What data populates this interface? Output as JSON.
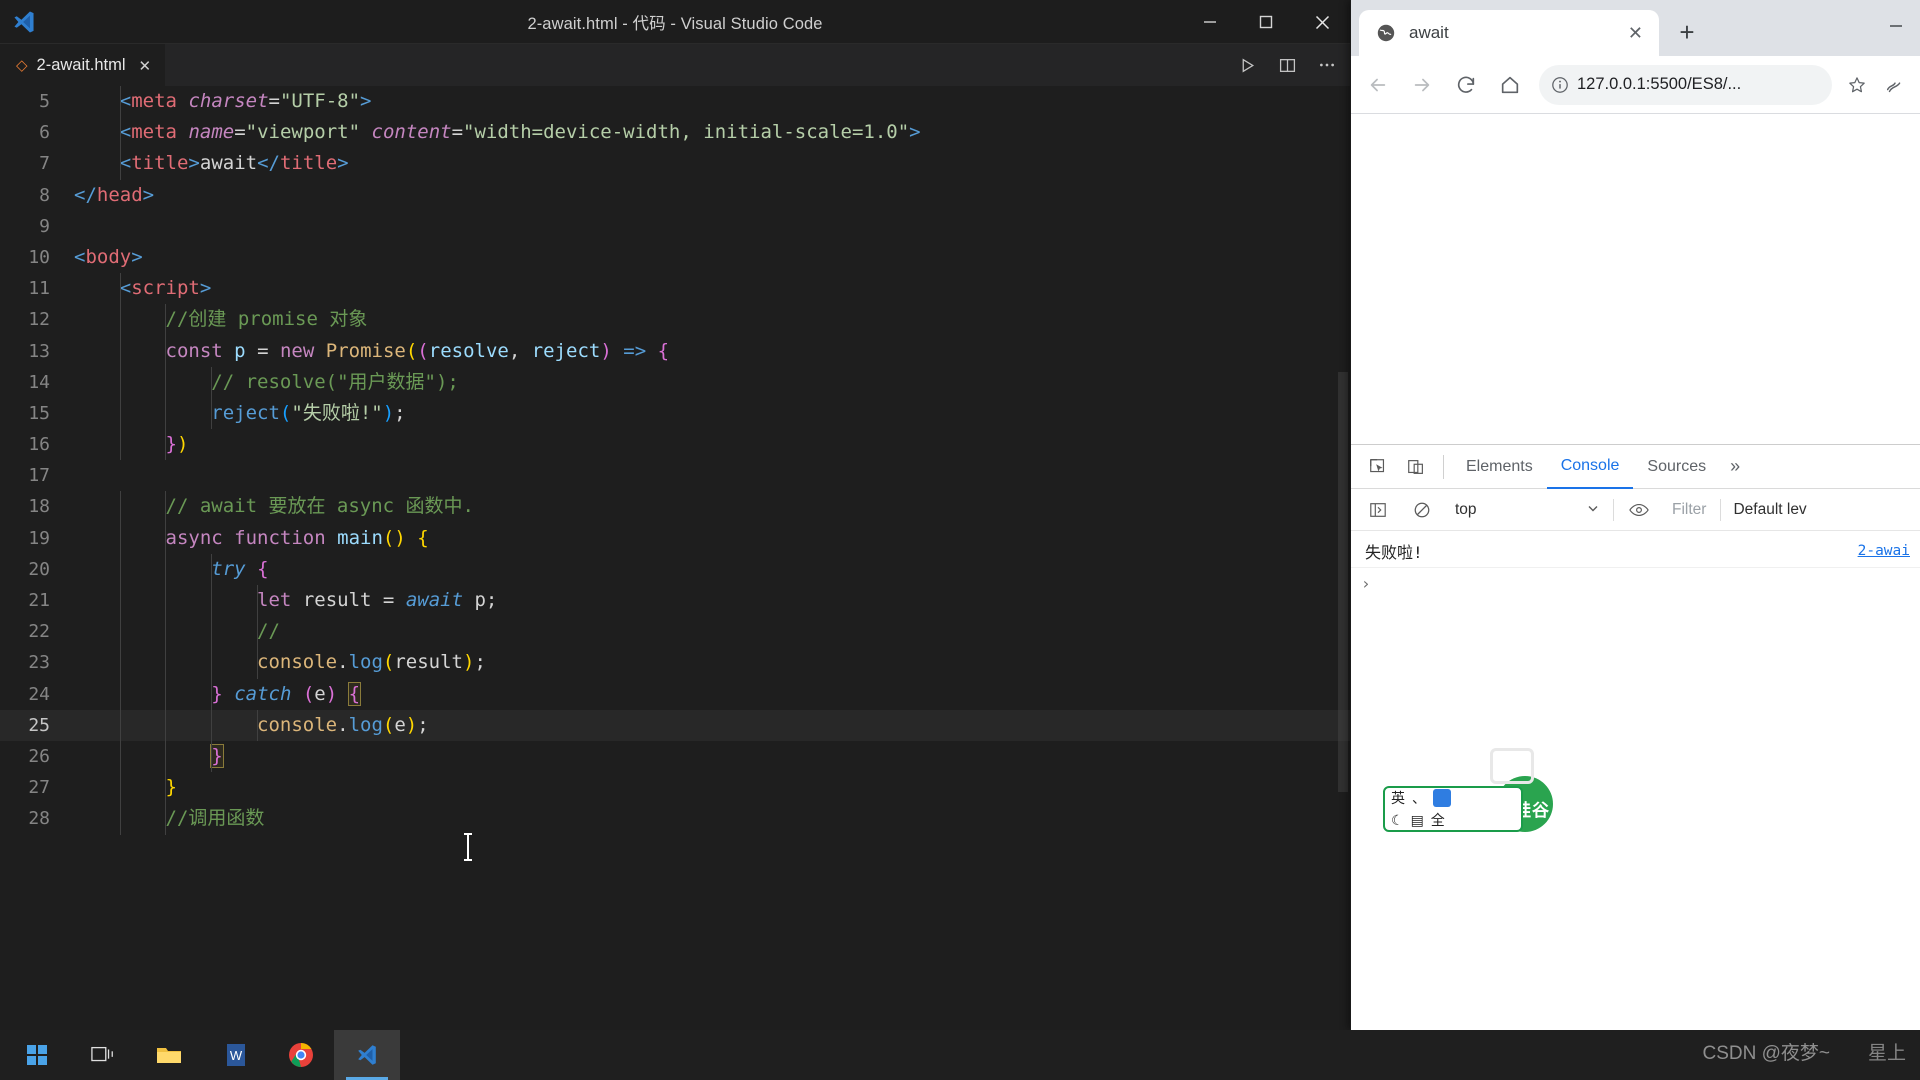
{
  "vscode": {
    "window_title": "2-await.html - 代码 - Visual Studio Code",
    "logo_icon": "vscode-logo-icon",
    "tab": {
      "file_icon": "html-file-icon",
      "label": "2-await.html",
      "close_icon": "close-icon"
    },
    "tab_actions": [
      {
        "name": "run-button",
        "icon": "play-icon"
      },
      {
        "name": "split-editor-button",
        "icon": "split-editor-icon"
      },
      {
        "name": "more-actions-button",
        "icon": "ellipsis-icon"
      }
    ],
    "window_controls": [
      {
        "name": "minimize-button",
        "icon": "minimize-icon"
      },
      {
        "name": "maximize-button",
        "icon": "maximize-icon"
      },
      {
        "name": "close-button",
        "icon": "close-icon"
      }
    ],
    "code": [
      {
        "n": "5",
        "cur": false,
        "indent": 2,
        "tokens": [
          {
            "t": "    ",
            "c": "t-txt"
          },
          {
            "t": "<",
            "c": "t-tag"
          },
          {
            "t": "meta",
            "c": "t-tagname"
          },
          {
            "t": " ",
            "c": "t-txt"
          },
          {
            "t": "charset",
            "c": "t-attr"
          },
          {
            "t": "=",
            "c": "t-pun"
          },
          {
            "t": "\"UTF-8\"",
            "c": "t-strv"
          },
          {
            "t": ">",
            "c": "t-tag"
          }
        ]
      },
      {
        "n": "6",
        "cur": false,
        "indent": 2,
        "tokens": [
          {
            "t": "    ",
            "c": "t-txt"
          },
          {
            "t": "<",
            "c": "t-tag"
          },
          {
            "t": "meta",
            "c": "t-tagname"
          },
          {
            "t": " ",
            "c": "t-txt"
          },
          {
            "t": "name",
            "c": "t-attr"
          },
          {
            "t": "=",
            "c": "t-pun"
          },
          {
            "t": "\"viewport\"",
            "c": "t-strv"
          },
          {
            "t": " ",
            "c": "t-txt"
          },
          {
            "t": "content",
            "c": "t-attr"
          },
          {
            "t": "=",
            "c": "t-pun"
          },
          {
            "t": "\"width=device-width, initial-scale=1.0\"",
            "c": "t-strv"
          },
          {
            "t": ">",
            "c": "t-tag"
          }
        ]
      },
      {
        "n": "7",
        "cur": false,
        "indent": 2,
        "tokens": [
          {
            "t": "    ",
            "c": "t-txt"
          },
          {
            "t": "<",
            "c": "t-tag"
          },
          {
            "t": "title",
            "c": "t-tagname"
          },
          {
            "t": ">",
            "c": "t-tag"
          },
          {
            "t": "await",
            "c": "t-txt"
          },
          {
            "t": "</",
            "c": "t-tag"
          },
          {
            "t": "title",
            "c": "t-tagname"
          },
          {
            "t": ">",
            "c": "t-tag"
          }
        ]
      },
      {
        "n": "8",
        "cur": false,
        "indent": 1,
        "tokens": [
          {
            "t": "</",
            "c": "t-tag"
          },
          {
            "t": "head",
            "c": "t-tagname"
          },
          {
            "t": ">",
            "c": "t-tag"
          }
        ]
      },
      {
        "n": "9",
        "cur": false,
        "indent": 0,
        "tokens": []
      },
      {
        "n": "10",
        "cur": false,
        "indent": 1,
        "tokens": [
          {
            "t": "<",
            "c": "t-tag"
          },
          {
            "t": "body",
            "c": "t-tagname"
          },
          {
            "t": ">",
            "c": "t-tag"
          }
        ]
      },
      {
        "n": "11",
        "cur": false,
        "indent": 2,
        "tokens": [
          {
            "t": "    ",
            "c": "t-txt"
          },
          {
            "t": "<",
            "c": "t-tag"
          },
          {
            "t": "script",
            "c": "t-tagname"
          },
          {
            "t": ">",
            "c": "t-tag"
          }
        ]
      },
      {
        "n": "12",
        "cur": false,
        "indent": 3,
        "tokens": [
          {
            "t": "        ",
            "c": "t-txt"
          },
          {
            "t": "//创建 promise 对象",
            "c": "t-cmt"
          }
        ]
      },
      {
        "n": "13",
        "cur": false,
        "indent": 3,
        "tokens": [
          {
            "t": "        ",
            "c": "t-txt"
          },
          {
            "t": "const",
            "c": "t-kw"
          },
          {
            "t": " ",
            "c": "t-txt"
          },
          {
            "t": "p",
            "c": "t-var"
          },
          {
            "t": " ",
            "c": "t-txt"
          },
          {
            "t": "=",
            "c": "t-pun"
          },
          {
            "t": " ",
            "c": "t-txt"
          },
          {
            "t": "new",
            "c": "t-kw"
          },
          {
            "t": " ",
            "c": "t-txt"
          },
          {
            "t": "Promise",
            "c": "t-obj"
          },
          {
            "t": "(",
            "c": "t-br1"
          },
          {
            "t": "(",
            "c": "t-br2"
          },
          {
            "t": "resolve",
            "c": "t-var"
          },
          {
            "t": ",",
            "c": "t-pun"
          },
          {
            "t": " ",
            "c": "t-txt"
          },
          {
            "t": "reject",
            "c": "t-var"
          },
          {
            "t": ")",
            "c": "t-br2"
          },
          {
            "t": " ",
            "c": "t-txt"
          },
          {
            "t": "=>",
            "c": "t-kw2"
          },
          {
            "t": " ",
            "c": "t-txt"
          },
          {
            "t": "{",
            "c": "t-br2"
          }
        ]
      },
      {
        "n": "14",
        "cur": false,
        "indent": 4,
        "tokens": [
          {
            "t": "            ",
            "c": "t-txt"
          },
          {
            "t": "// resolve(\"用户数据\");",
            "c": "t-cmt"
          }
        ]
      },
      {
        "n": "15",
        "cur": false,
        "indent": 4,
        "tokens": [
          {
            "t": "            ",
            "c": "t-txt"
          },
          {
            "t": "reject",
            "c": "t-kw2"
          },
          {
            "t": "(",
            "c": "t-br3"
          },
          {
            "t": "\"失败啦!\"",
            "c": "t-strv"
          },
          {
            "t": ")",
            "c": "t-br3"
          },
          {
            "t": ";",
            "c": "t-pun"
          }
        ]
      },
      {
        "n": "16",
        "cur": false,
        "indent": 3,
        "tokens": [
          {
            "t": "        ",
            "c": "t-txt"
          },
          {
            "t": "}",
            "c": "t-br2"
          },
          {
            "t": ")",
            "c": "t-br1"
          }
        ]
      },
      {
        "n": "17",
        "cur": false,
        "indent": 0,
        "tokens": []
      },
      {
        "n": "18",
        "cur": false,
        "indent": 3,
        "tokens": [
          {
            "t": "        ",
            "c": "t-txt"
          },
          {
            "t": "// await 要放在 async 函数中.",
            "c": "t-cmt"
          }
        ]
      },
      {
        "n": "19",
        "cur": false,
        "indent": 3,
        "tokens": [
          {
            "t": "        ",
            "c": "t-txt"
          },
          {
            "t": "async",
            "c": "t-kw"
          },
          {
            "t": " ",
            "c": "t-txt"
          },
          {
            "t": "function",
            "c": "t-kw"
          },
          {
            "t": " ",
            "c": "t-txt"
          },
          {
            "t": "main",
            "c": "t-var"
          },
          {
            "t": "(",
            "c": "t-br1"
          },
          {
            "t": ")",
            "c": "t-br1"
          },
          {
            "t": " ",
            "c": "t-txt"
          },
          {
            "t": "{",
            "c": "t-br1"
          }
        ]
      },
      {
        "n": "20",
        "cur": false,
        "indent": 4,
        "tokens": [
          {
            "t": "            ",
            "c": "t-txt"
          },
          {
            "t": "try",
            "c": "t-kw2 t-italic"
          },
          {
            "t": " ",
            "c": "t-txt"
          },
          {
            "t": "{",
            "c": "t-br2"
          }
        ]
      },
      {
        "n": "21",
        "cur": false,
        "indent": 5,
        "tokens": [
          {
            "t": "                ",
            "c": "t-txt"
          },
          {
            "t": "let",
            "c": "t-kw"
          },
          {
            "t": " ",
            "c": "t-txt"
          },
          {
            "t": "result",
            "c": "t-txt"
          },
          {
            "t": " ",
            "c": "t-txt"
          },
          {
            "t": "=",
            "c": "t-pun"
          },
          {
            "t": " ",
            "c": "t-txt"
          },
          {
            "t": "await",
            "c": "t-kw2 t-italic"
          },
          {
            "t": " ",
            "c": "t-txt"
          },
          {
            "t": "p",
            "c": "t-txt"
          },
          {
            "t": ";",
            "c": "t-pun"
          }
        ]
      },
      {
        "n": "22",
        "cur": false,
        "indent": 5,
        "tokens": [
          {
            "t": "                ",
            "c": "t-txt"
          },
          {
            "t": "//",
            "c": "t-cmt"
          }
        ]
      },
      {
        "n": "23",
        "cur": false,
        "indent": 5,
        "tokens": [
          {
            "t": "                ",
            "c": "t-txt"
          },
          {
            "t": "console",
            "c": "t-obj"
          },
          {
            "t": ".",
            "c": "t-pun"
          },
          {
            "t": "log",
            "c": "t-kw2"
          },
          {
            "t": "(",
            "c": "t-br1"
          },
          {
            "t": "result",
            "c": "t-txt"
          },
          {
            "t": ")",
            "c": "t-br1"
          },
          {
            "t": ";",
            "c": "t-pun"
          }
        ]
      },
      {
        "n": "24",
        "cur": false,
        "indent": 4,
        "tokens": [
          {
            "t": "            ",
            "c": "t-txt"
          },
          {
            "t": "}",
            "c": "t-br2"
          },
          {
            "t": " ",
            "c": "t-txt"
          },
          {
            "t": "catch",
            "c": "t-kw2 t-italic"
          },
          {
            "t": " ",
            "c": "t-txt"
          },
          {
            "t": "(",
            "c": "t-br2"
          },
          {
            "t": "e",
            "c": "t-txt"
          },
          {
            "t": ")",
            "c": "t-br2"
          },
          {
            "t": " ",
            "c": "t-txt"
          },
          {
            "t": "{",
            "c": "t-br2 bracket-hl"
          }
        ]
      },
      {
        "n": "25",
        "cur": true,
        "indent": 5,
        "tokens": [
          {
            "t": "                ",
            "c": "t-txt"
          },
          {
            "t": "console",
            "c": "t-obj"
          },
          {
            "t": ".",
            "c": "t-pun"
          },
          {
            "t": "log",
            "c": "t-kw2"
          },
          {
            "t": "(",
            "c": "t-br1"
          },
          {
            "t": "e",
            "c": "t-txt"
          },
          {
            "t": ")",
            "c": "t-br1"
          },
          {
            "t": ";",
            "c": "t-pun"
          }
        ]
      },
      {
        "n": "26",
        "cur": false,
        "indent": 4,
        "tokens": [
          {
            "t": "            ",
            "c": "t-txt"
          },
          {
            "t": "}",
            "c": "t-br2 bracket-hl"
          }
        ]
      },
      {
        "n": "27",
        "cur": false,
        "indent": 3,
        "tokens": [
          {
            "t": "        ",
            "c": "t-txt"
          },
          {
            "t": "}",
            "c": "t-br1"
          }
        ]
      },
      {
        "n": "28",
        "cur": false,
        "indent": 3,
        "tokens": [
          {
            "t": "        ",
            "c": "t-txt"
          },
          {
            "t": "//调用函数",
            "c": "t-cmt"
          }
        ]
      }
    ]
  },
  "chrome": {
    "tab": {
      "favicon": "globe-icon",
      "title": "await",
      "close_icon": "close-icon"
    },
    "new_tab_label": "+",
    "nav": {
      "back_icon": "arrow-left-icon",
      "forward_icon": "arrow-right-icon",
      "reload_icon": "reload-icon",
      "home_icon": "home-icon",
      "info_icon": "info-circle-icon",
      "star_icon": "star-icon",
      "profile_icon": "profile-icon"
    },
    "url": "127.0.0.1:5500/ES8/...",
    "window_controls": [
      {
        "name": "minimize-button",
        "icon": "minimize-icon"
      }
    ],
    "devtools": {
      "left_icons": [
        {
          "name": "inspect-element-icon",
          "icon": "cursor-box-icon"
        },
        {
          "name": "device-toolbar-icon",
          "icon": "device-icon"
        }
      ],
      "tabs": [
        {
          "label": "Elements",
          "active": false
        },
        {
          "label": "Console",
          "active": true
        },
        {
          "label": "Sources",
          "active": false
        }
      ],
      "more_tabs_icon": "chevron-right-double-icon",
      "filterbar": {
        "sidebar_icon": "console-sidebar-icon",
        "clear_icon": "clear-console-icon",
        "context": "top",
        "context_caret": "chevron-down-icon",
        "eye_icon": "eye-icon",
        "filter_placeholder": "Filter",
        "level": "Default lev"
      },
      "messages": [
        {
          "text": "失败啦!",
          "source": "2-awai"
        }
      ],
      "prompt_arrow": "›"
    }
  },
  "ime": {
    "lang_label": "英",
    "dot_label": "、",
    "badge_icon": "user-icon",
    "moon_icon": "moon-icon",
    "keyboard_icon": "keyboard-icon",
    "full_label": "全"
  },
  "brand": {
    "name": "尚硅谷",
    "play_icon": "play-box-icon"
  },
  "taskbar": {
    "items": [
      {
        "name": "start-button",
        "icon": "windows-logo-icon",
        "active": false
      },
      {
        "name": "task-view-button",
        "icon": "task-view-icon",
        "active": false
      },
      {
        "name": "file-explorer-button",
        "icon": "folder-icon",
        "active": false
      },
      {
        "name": "word-button",
        "icon": "word-icon",
        "active": false
      },
      {
        "name": "chrome-button",
        "icon": "chrome-icon",
        "active": false
      },
      {
        "name": "vscode-button",
        "icon": "vscode-icon",
        "active": true
      }
    ],
    "watermark": "CSDN @夜梦~",
    "watermark2": "星上"
  }
}
